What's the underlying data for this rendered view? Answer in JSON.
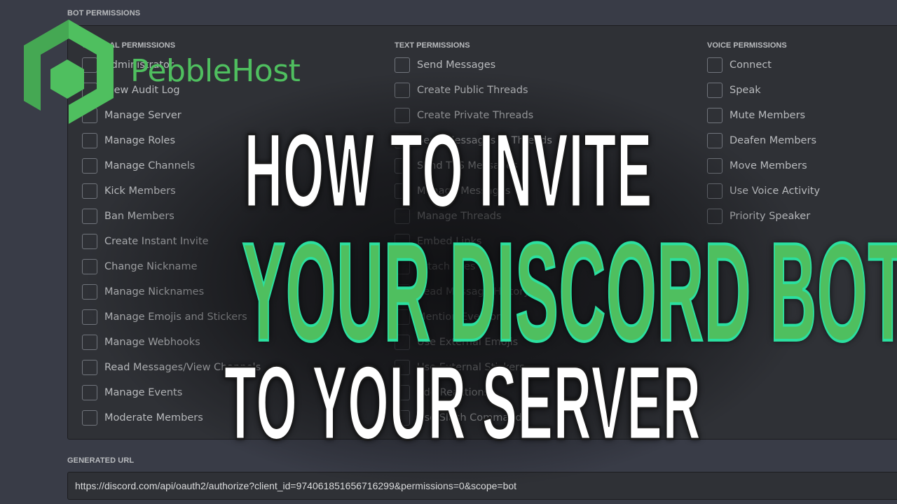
{
  "bot_permissions_label": "BOT PERMISSIONS",
  "columns": [
    {
      "title": "GENERAL PERMISSIONS",
      "items": [
        "Administrator",
        "View Audit Log",
        "Manage Server",
        "Manage Roles",
        "Manage Channels",
        "Kick Members",
        "Ban Members",
        "Create Instant Invite",
        "Change Nickname",
        "Manage Nicknames",
        "Manage Emojis and Stickers",
        "Manage Webhooks",
        "Read Messages/View Channels",
        "Manage Events",
        "Moderate Members"
      ]
    },
    {
      "title": "TEXT PERMISSIONS",
      "items": [
        "Send Messages",
        "Create Public Threads",
        "Create Private Threads",
        "Send Messages in Threads",
        "Send TTS Messages",
        "Manage Messages",
        "Manage Threads",
        "Embed Links",
        "Attach Files",
        "Read Message History",
        "Mention Everyone",
        "Use External Emojis",
        "Use External Stickers",
        "Add Reactions",
        "Use Slash Commands"
      ]
    },
    {
      "title": "VOICE PERMISSIONS",
      "items": [
        "Connect",
        "Speak",
        "Mute Members",
        "Deafen Members",
        "Move Members",
        "Use Voice Activity",
        "Priority Speaker"
      ]
    }
  ],
  "generated_url_label": "GENERATED URL",
  "generated_url": "https://discord.com/api/oauth2/authorize?client_id=974061851656716299&permissions=0&scope=bot",
  "overlay": {
    "brand": "PebbleHost",
    "line1": "HOW TO INVITE",
    "line2": "YOUR DISCORD BOT",
    "line3": "TO YOUR SERVER"
  },
  "colors": {
    "brand_green": "#4fbf5f",
    "outline_teal": "#2be0a0"
  }
}
